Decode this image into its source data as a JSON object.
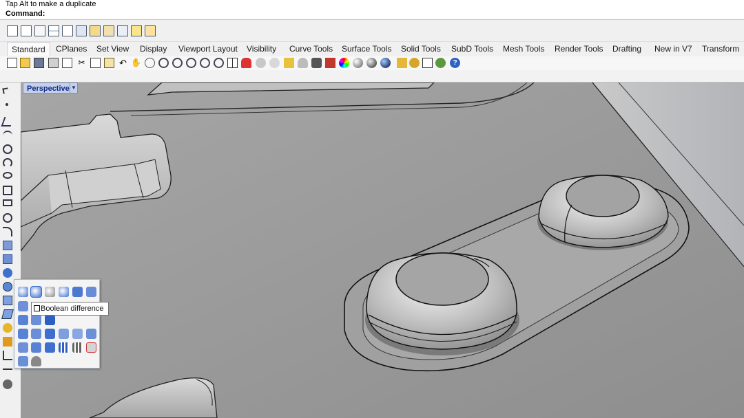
{
  "command": {
    "history_text": "Tap Alt to make a duplicate",
    "prompt_label": "Command:"
  },
  "tabs": [
    {
      "label": "Standard",
      "active": true
    },
    {
      "label": "CPlanes"
    },
    {
      "label": "Set View"
    },
    {
      "label": "Display"
    },
    {
      "label": "Viewport Layout"
    },
    {
      "label": "Visibility"
    },
    {
      "label": "Curve Tools"
    },
    {
      "label": "Surface Tools"
    },
    {
      "label": "Solid Tools"
    },
    {
      "label": "SubD Tools"
    },
    {
      "label": "Mesh Tools"
    },
    {
      "label": "Render Tools"
    },
    {
      "label": "Drafting"
    },
    {
      "label": "New in V7"
    },
    {
      "label": "Transform"
    }
  ],
  "viewport": {
    "label": "Perspective",
    "menu_icon": "triangle-down-icon"
  },
  "tooltip": {
    "text": "Boolean difference"
  },
  "icons": {
    "top_toolbar": [
      "new-file-icon",
      "template-icon",
      "page-icon",
      "grid-icon",
      "add-icon",
      "layout-icon",
      "open-folder-icon",
      "edit-icon",
      "document-icon",
      "properties-icon",
      "settings-icon"
    ],
    "standard_toolbar": [
      "new-icon",
      "open-icon",
      "save-icon",
      "print-icon",
      "import-icon",
      "cut-icon",
      "copy-icon",
      "paste-icon",
      "undo-icon",
      "pan-icon",
      "rotate-view-icon",
      "zoom-icon",
      "zoom-window-icon",
      "zoom-extents-icon",
      "zoom-selected-icon",
      "zoom-dynamic-icon",
      "viewport-layout-icon",
      "car-icon",
      "hide-icon",
      "show-icon",
      "select-icon",
      "light-icon",
      "lock-icon",
      "material-icon",
      "color-wheel-icon",
      "render-sphere-icon",
      "render-preview-icon",
      "environment-icon",
      "texture-icon",
      "options-icon",
      "rhino-icon",
      "help-icon"
    ],
    "left_toolbar": [
      "select-arrow-icon",
      "point-icon",
      "polyline-icon",
      "curve-icon",
      "circle-icon",
      "arc-icon",
      "ellipse-icon",
      "polygon-icon",
      "rectangle-icon",
      "text-icon",
      "surface-icon",
      "extrude-icon",
      "box-icon",
      "sphere-icon",
      "boolean-union-icon",
      "mesh-icon",
      "transform-icon",
      "array-icon",
      "dimension-icon",
      "render-icon",
      "layer-icon",
      "object-icon"
    ],
    "flyout": [
      "boolean-union-icon",
      "boolean-difference-icon",
      "boolean-intersection-icon",
      "boolean-split-icon",
      "cap-icon",
      "solid-edit-icon",
      "extract-surface-icon",
      "shell-icon",
      "merge-icon",
      "wire-cut-icon",
      "fillet-edge-icon",
      "chamfer-edge-icon",
      "move-face-icon",
      "extrude-face-icon",
      "offset-icon",
      "blend-icon",
      "rib-icon",
      "split-icon",
      "make-hole-icon",
      "move-hole-icon",
      "rotate-hole-icon",
      "array-hole-icon",
      "mesh-box-icon",
      "delete-face-icon",
      "solid-history-icon",
      "bucket-icon"
    ]
  },
  "colors": {
    "accent": "#c6d0e8",
    "viewport_label_text": "#0b2a8a",
    "model_surface": "#9a9a9a"
  }
}
